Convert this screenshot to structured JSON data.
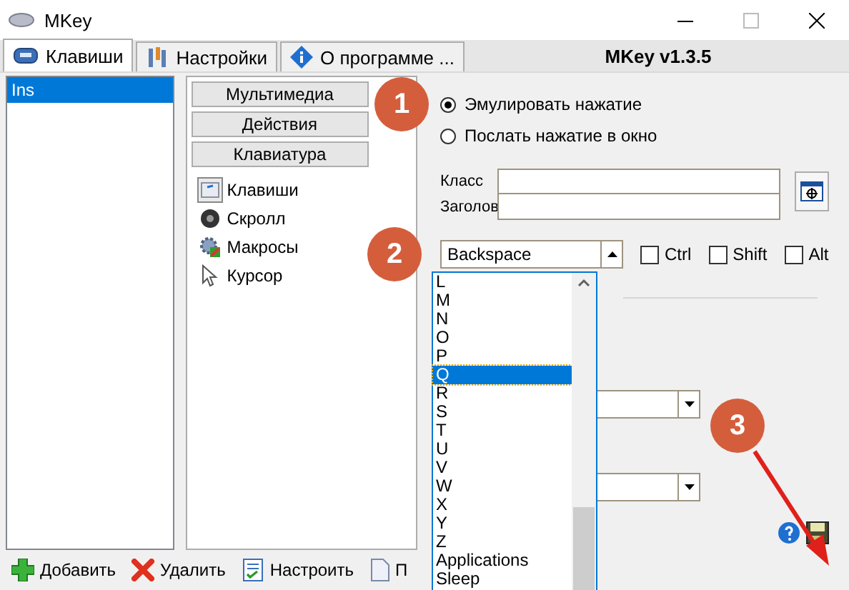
{
  "window": {
    "title": "MKey"
  },
  "tabs": [
    {
      "label": "Клавиши",
      "kind": "keys",
      "selected": true
    },
    {
      "label": "Настройки",
      "kind": "settings",
      "selected": false
    },
    {
      "label": "О программе ...",
      "kind": "about",
      "selected": false
    }
  ],
  "version": "MKey v1.3.5",
  "key_list": [
    {
      "label": "Ins",
      "selected": true
    }
  ],
  "categories": [
    {
      "label": "Мультимедиа"
    },
    {
      "label": "Действия"
    },
    {
      "label": "Клавиатура"
    }
  ],
  "actions": [
    {
      "label": "Клавиши",
      "kind": "keys",
      "selected": true
    },
    {
      "label": "Скролл",
      "kind": "scroll",
      "selected": false
    },
    {
      "label": "Макросы",
      "kind": "macros",
      "selected": false
    },
    {
      "label": "Курсор",
      "kind": "cursor",
      "selected": false
    }
  ],
  "mode_options": [
    {
      "label": "Эмулировать нажатие",
      "selected": true
    },
    {
      "label": "Послать нажатие в окно",
      "selected": false
    }
  ],
  "target": {
    "class_label": "Класс",
    "title_label": "Заголов"
  },
  "key_combo": {
    "value": "Backspace",
    "expanded": true
  },
  "modifiers": [
    {
      "label": "Ctrl",
      "checked": false
    },
    {
      "label": "Shift",
      "checked": false
    },
    {
      "label": "Alt",
      "checked": false
    }
  ],
  "key_dropdown": [
    {
      "label": "L",
      "selected": false
    },
    {
      "label": "M",
      "selected": false
    },
    {
      "label": "N",
      "selected": false
    },
    {
      "label": "O",
      "selected": false
    },
    {
      "label": "P",
      "selected": false
    },
    {
      "label": "Q",
      "selected": true
    },
    {
      "label": "R",
      "selected": false
    },
    {
      "label": "S",
      "selected": false
    },
    {
      "label": "T",
      "selected": false
    },
    {
      "label": "U",
      "selected": false
    },
    {
      "label": "V",
      "selected": false
    },
    {
      "label": "W",
      "selected": false
    },
    {
      "label": "X",
      "selected": false
    },
    {
      "label": "Y",
      "selected": false
    },
    {
      "label": "Z",
      "selected": false
    },
    {
      "label": "Applications",
      "selected": false
    },
    {
      "label": "Sleep",
      "selected": false
    }
  ],
  "toolbar": [
    {
      "label": "Добавить",
      "kind": "add"
    },
    {
      "label": "Удалить",
      "kind": "delete"
    },
    {
      "label": "Настроить",
      "kind": "configure"
    },
    {
      "label": "П",
      "kind": "document"
    }
  ],
  "annotations": [
    {
      "label": "1"
    },
    {
      "label": "2"
    },
    {
      "label": "3"
    }
  ]
}
